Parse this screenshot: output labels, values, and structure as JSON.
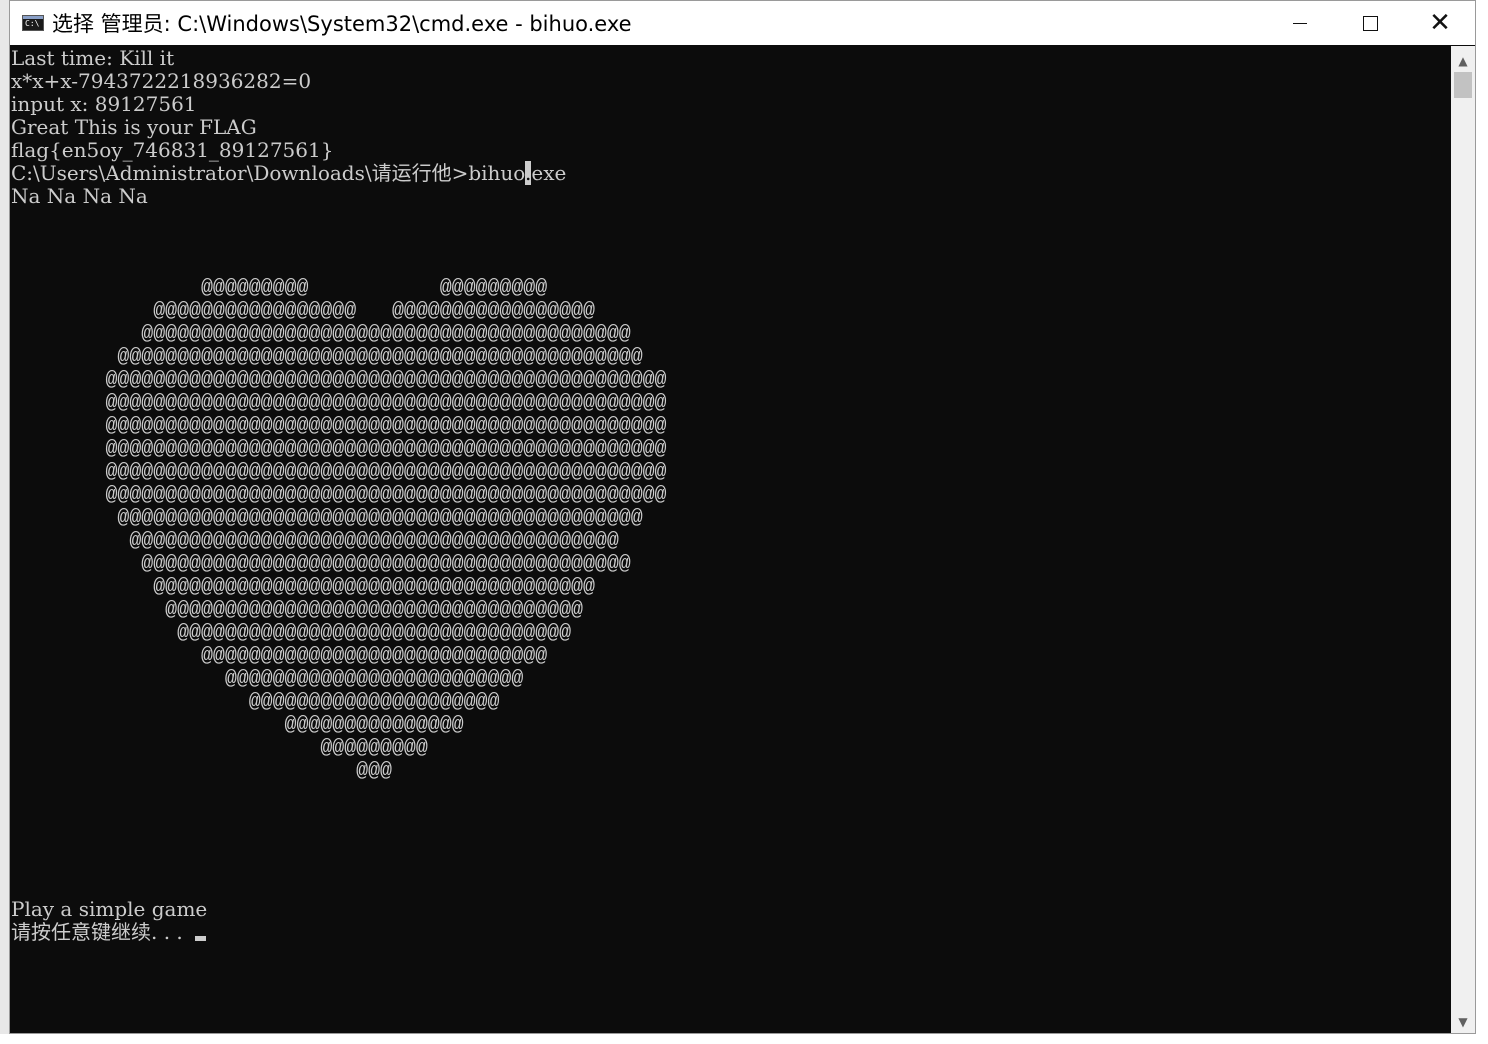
{
  "window": {
    "title": "选择 管理员: C:\\Windows\\System32\\cmd.exe - bihuo.exe",
    "controls": {
      "minimize_icon": "minimize-icon",
      "maximize_icon": "maximize-icon",
      "close_icon": "close-icon",
      "close_glyph": "✕"
    }
  },
  "console": {
    "lines": [
      "Last time: Kill it",
      "x*x+x-7943722218936282=0",
      "input x: 89127561",
      "Great This is your FLAG",
      "flag{en5oy_746831_89127561}"
    ],
    "prompt_before_cursor": "C:\\Users\\Administrator\\Downloads\\请运行他>bihuo",
    "prompt_selected": ".",
    "prompt_after_cursor": "exe",
    "na_line": "Na Na Na Na",
    "heart": [
      "                @@@@@@@@@           @@@@@@@@@",
      "            @@@@@@@@@@@@@@@@@   @@@@@@@@@@@@@@@@@",
      "           @@@@@@@@@@@@@@@@@@@@@@@@@@@@@@@@@@@@@@@@@",
      "         @@@@@@@@@@@@@@@@@@@@@@@@@@@@@@@@@@@@@@@@@@@@",
      "        @@@@@@@@@@@@@@@@@@@@@@@@@@@@@@@@@@@@@@@@@@@@@@@",
      "        @@@@@@@@@@@@@@@@@@@@@@@@@@@@@@@@@@@@@@@@@@@@@@@",
      "        @@@@@@@@@@@@@@@@@@@@@@@@@@@@@@@@@@@@@@@@@@@@@@@",
      "        @@@@@@@@@@@@@@@@@@@@@@@@@@@@@@@@@@@@@@@@@@@@@@@",
      "        @@@@@@@@@@@@@@@@@@@@@@@@@@@@@@@@@@@@@@@@@@@@@@@",
      "        @@@@@@@@@@@@@@@@@@@@@@@@@@@@@@@@@@@@@@@@@@@@@@@",
      "         @@@@@@@@@@@@@@@@@@@@@@@@@@@@@@@@@@@@@@@@@@@@",
      "          @@@@@@@@@@@@@@@@@@@@@@@@@@@@@@@@@@@@@@@@@",
      "           @@@@@@@@@@@@@@@@@@@@@@@@@@@@@@@@@@@@@@@@@",
      "            @@@@@@@@@@@@@@@@@@@@@@@@@@@@@@@@@@@@@",
      "             @@@@@@@@@@@@@@@@@@@@@@@@@@@@@@@@@@@",
      "              @@@@@@@@@@@@@@@@@@@@@@@@@@@@@@@@@",
      "                @@@@@@@@@@@@@@@@@@@@@@@@@@@@@",
      "                  @@@@@@@@@@@@@@@@@@@@@@@@@",
      "                    @@@@@@@@@@@@@@@@@@@@@",
      "                       @@@@@@@@@@@@@@@",
      "                          @@@@@@@@@",
      "                             @@@"
    ],
    "game_line": "Play a simple game",
    "press_key_line": "请按任意键继续. . ."
  },
  "scrollbar": {
    "up_icon": "scroll-up-arrow-icon",
    "down_icon": "scroll-down-arrow-icon",
    "up_glyph": "▲",
    "down_glyph": "▼"
  },
  "colors": {
    "console_bg": "#0c0c0c",
    "console_fg": "#cccccc",
    "titlebar_bg": "#ffffff"
  }
}
